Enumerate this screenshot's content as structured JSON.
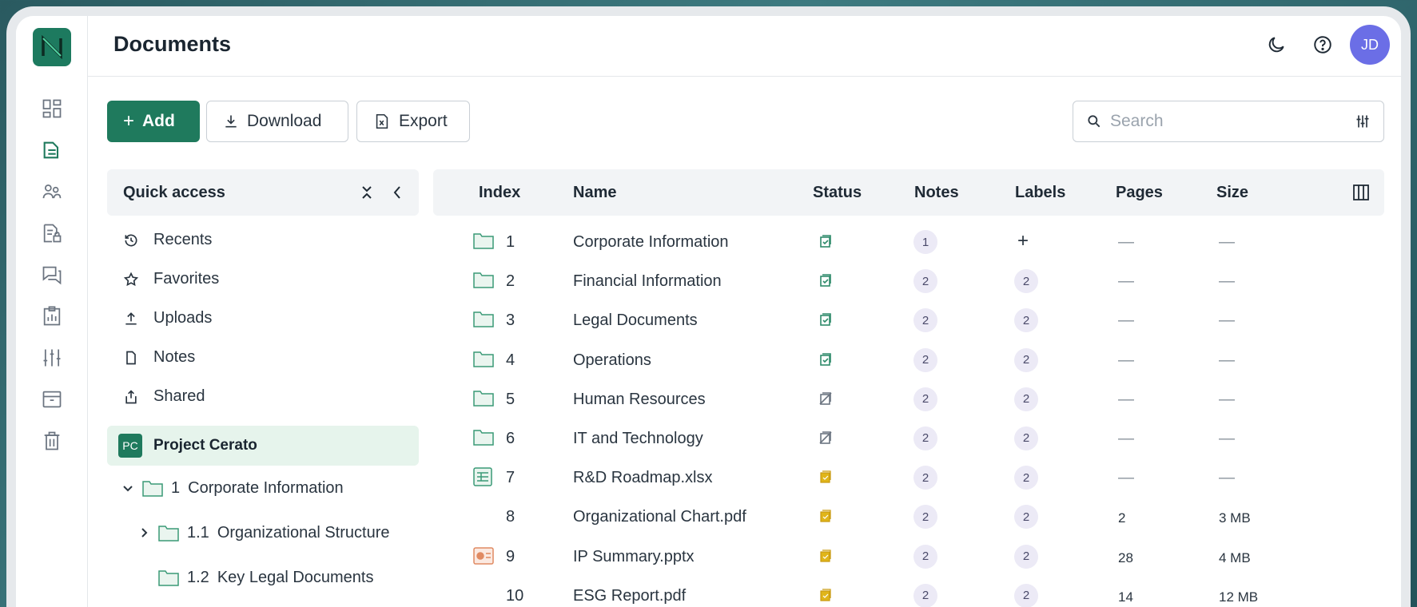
{
  "header": {
    "title": "Documents",
    "avatar_initials": "JD"
  },
  "toolbar": {
    "add_label": "Add",
    "download_label": "Download",
    "export_label": "Export",
    "search_placeholder": "Search"
  },
  "quick_access": {
    "title": "Quick access",
    "items": [
      {
        "label": "Recents",
        "icon": "history-icon"
      },
      {
        "label": "Favorites",
        "icon": "star-icon"
      },
      {
        "label": "Uploads",
        "icon": "upload-icon"
      },
      {
        "label": "Notes",
        "icon": "file-icon"
      },
      {
        "label": "Shared",
        "icon": "share-icon"
      }
    ],
    "project": {
      "badge": "PC",
      "name": "Project Cerato"
    },
    "tree": [
      {
        "number": "1",
        "label": "Corporate Information"
      },
      {
        "number": "1.1",
        "label": "Organizational Structure"
      },
      {
        "number": "1.2",
        "label": "Key Legal Documents"
      }
    ]
  },
  "table": {
    "columns": [
      "Index",
      "Name",
      "Status",
      "Notes",
      "Labels",
      "Pages",
      "Size"
    ],
    "rows": [
      {
        "index": "1",
        "name": "Corporate Information",
        "type": "folder",
        "status": "reviewed",
        "notes": "1",
        "labels": "+",
        "pages": "—",
        "size": "—"
      },
      {
        "index": "2",
        "name": "Financial Information",
        "type": "folder",
        "status": "reviewed",
        "notes": "2",
        "labels": "2",
        "pages": "—",
        "size": "—"
      },
      {
        "index": "3",
        "name": "Legal Documents",
        "type": "folder",
        "status": "reviewed",
        "notes": "2",
        "labels": "2",
        "pages": "—",
        "size": "—"
      },
      {
        "index": "4",
        "name": "Operations",
        "type": "folder",
        "status": "reviewed",
        "notes": "2",
        "labels": "2",
        "pages": "—",
        "size": "—"
      },
      {
        "index": "5",
        "name": "Human Resources",
        "type": "folder",
        "status": "not-reviewed",
        "notes": "2",
        "labels": "2",
        "pages": "—",
        "size": "—"
      },
      {
        "index": "6",
        "name": "IT and Technology",
        "type": "folder",
        "status": "not-reviewed",
        "notes": "2",
        "labels": "2",
        "pages": "—",
        "size": "—"
      },
      {
        "index": "7",
        "name": "R&D Roadmap.xlsx",
        "type": "spreadsheet",
        "status": "pending",
        "notes": "2",
        "labels": "2",
        "pages": "—",
        "size": "—"
      },
      {
        "index": "8",
        "name": "Organizational Chart.pdf",
        "type": "pdf",
        "status": "pending",
        "notes": "2",
        "labels": "2",
        "pages": "2",
        "size": "3 MB"
      },
      {
        "index": "9",
        "name": "IP Summary.pptx",
        "type": "presentation",
        "status": "pending",
        "notes": "2",
        "labels": "2",
        "pages": "28",
        "size": "4 MB"
      },
      {
        "index": "10",
        "name": "ESG Report.pdf",
        "type": "pdf",
        "status": "pending",
        "notes": "2",
        "labels": "2",
        "pages": "14",
        "size": "12 MB"
      }
    ]
  },
  "colors": {
    "brand": "#1f7a5d",
    "status_reviewed": "#2e8a6a",
    "status_not_reviewed": "#6b7480",
    "status_pending": "#e0b51a",
    "avatar": "#6b6ee6"
  }
}
